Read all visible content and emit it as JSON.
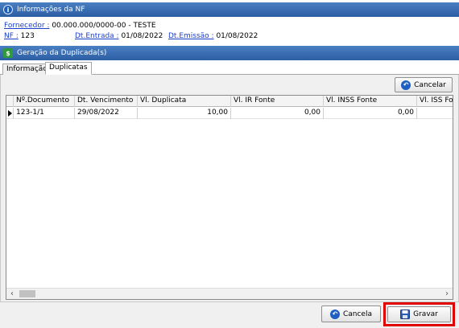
{
  "nf_section": {
    "icon": "info-icon",
    "title": "Informações da NF"
  },
  "fornecedor": {
    "label": "Fornecedor :",
    "value": " 00.000.000/0000-00 - TESTE"
  },
  "nf": {
    "label": "NF :",
    "value": " 123"
  },
  "dt_entrada": {
    "label": "Dt.Entrada :",
    "value": " 01/08/2022"
  },
  "dt_emissao": {
    "label": "Dt.Emissão :",
    "value": " 01/08/2022"
  },
  "dup_section": {
    "icon": "money-icon",
    "title": "Geração da Duplicada(s)"
  },
  "tabs": [
    {
      "label": "Informação"
    },
    {
      "label": "Duplicatas"
    }
  ],
  "cancelar_button": {
    "label": "Cancelar",
    "icon": "back-arrow-icon"
  },
  "table": {
    "columns": [
      "Nº.Documento",
      "Dt. Vencimento",
      "Vl. Duplicata",
      "Vl. IR Fonte",
      "Vl. INSS Fonte",
      "Vl. ISS Font"
    ],
    "rows": [
      [
        "123-1/1",
        "29/08/2022",
        "10,00",
        "0,00",
        "0,00",
        ""
      ]
    ]
  },
  "scroll": {
    "left": "‹",
    "right": "›"
  },
  "footer": {
    "cancela": {
      "label": "Cancela",
      "icon": "back-arrow-icon"
    },
    "gravar": {
      "label": "Gravar",
      "icon": "save-icon"
    }
  },
  "colors": {
    "header_bar": "#2c5ea3",
    "link": "#1a3ec7",
    "highlight": "#e00000"
  }
}
